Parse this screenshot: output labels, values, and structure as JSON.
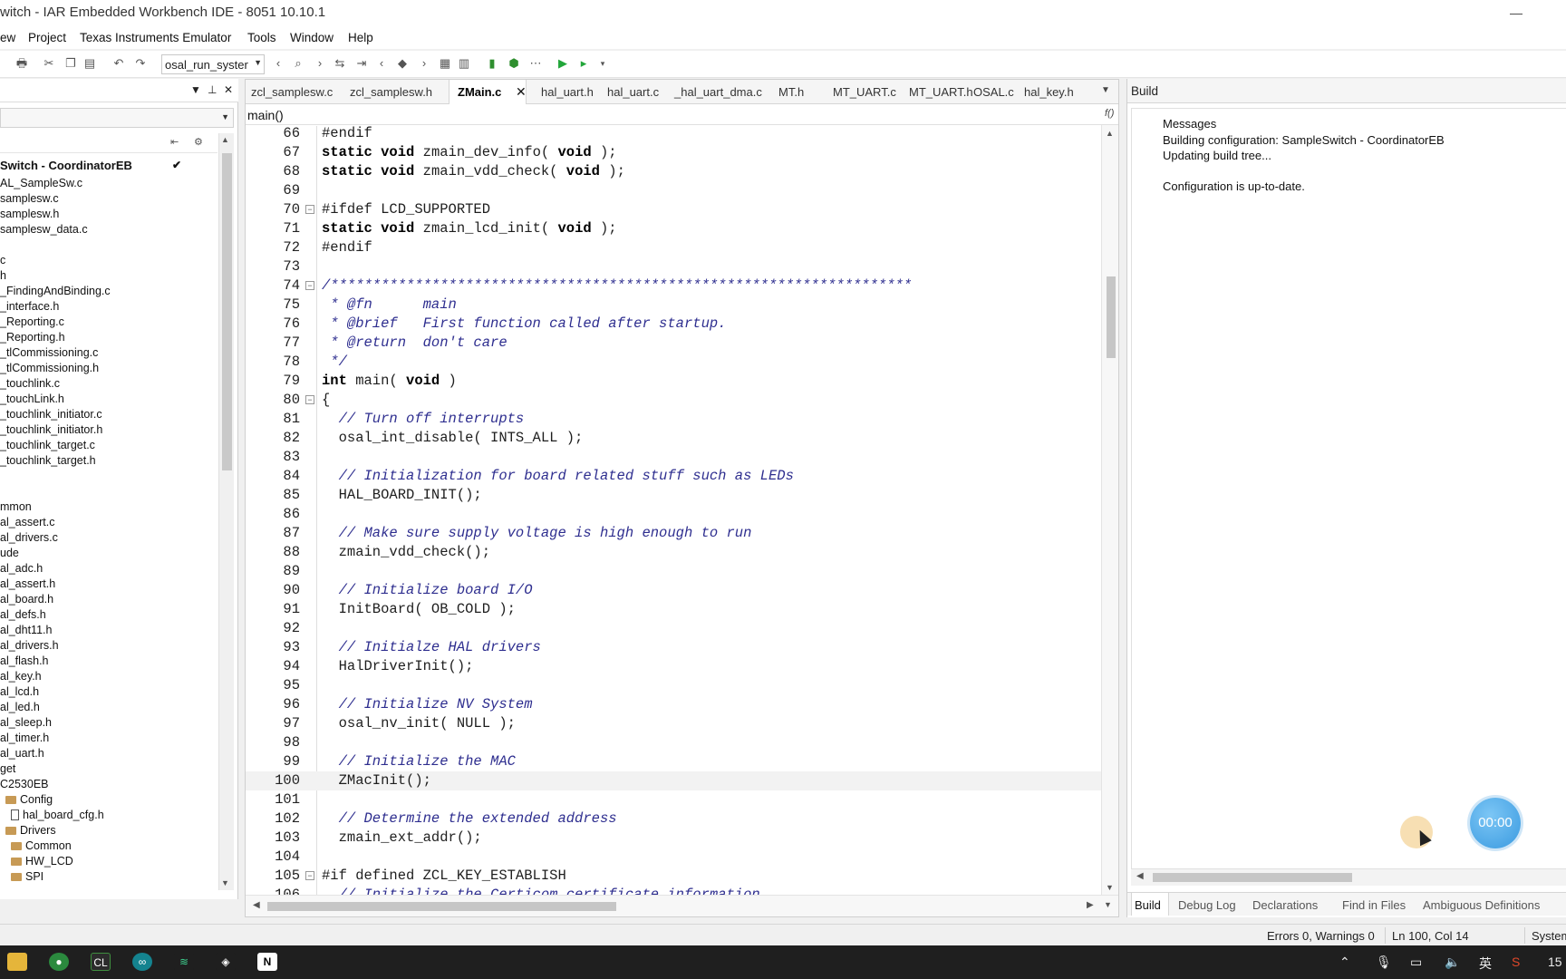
{
  "window": {
    "title": "witch - IAR Embedded Workbench IDE - 8051 10.10.1"
  },
  "menu": [
    "ew",
    "Project",
    "Texas Instruments Emulator",
    "Tools",
    "Window",
    "Help"
  ],
  "toolbar": {
    "config_combo": "osal_run_syster"
  },
  "workspace": {
    "project": "Switch - CoordinatorEB",
    "files": [
      "AL_SampleSw.c",
      "samplesw.c",
      "samplesw.h",
      "samplesw_data.c",
      "",
      "c",
      "h",
      "_FindingAndBinding.c",
      "_interface.h",
      "_Reporting.c",
      "_Reporting.h",
      "_tlCommissioning.c",
      "_tlCommissioning.h",
      "_touchlink.c",
      "_touchLink.h",
      "_touchlink_initiator.c",
      "_touchlink_initiator.h",
      "_touchlink_target.c",
      "_touchlink_target.h",
      "",
      "",
      "mmon",
      "al_assert.c",
      "al_drivers.c",
      "ude",
      "al_adc.h",
      "al_assert.h",
      "al_board.h",
      "al_defs.h",
      "al_dht11.h",
      "al_drivers.h",
      "al_flash.h",
      "al_key.h",
      "al_lcd.h",
      "al_led.h",
      "al_sleep.h",
      "al_timer.h",
      "al_uart.h",
      "get",
      "C2530EB"
    ],
    "groups": [
      {
        "label": "Config",
        "indent": 1
      },
      {
        "label": "hal_board_cfg.h",
        "indent": 2
      },
      {
        "label": "Drivers",
        "indent": 1
      },
      {
        "label": "Common",
        "indent": 2
      },
      {
        "label": "HW_LCD",
        "indent": 2
      },
      {
        "label": "SPI",
        "indent": 2
      }
    ]
  },
  "editor": {
    "tabs": [
      "zcl_samplesw.c",
      "zcl_samplesw.h",
      "ZMain.c",
      "hal_uart.h",
      "hal_uart.c",
      "_hal_uart_dma.c",
      "MT.h",
      "MT_UART.c",
      "MT_UART.h",
      "OSAL.c",
      "hal_key.h"
    ],
    "active_tab": "ZMain.c",
    "function": "main()",
    "current_line": "100",
    "lines": [
      {
        "n": "66",
        "t": "#endif",
        "fold": ""
      },
      {
        "n": "67",
        "t": "static void zmain_dev_info( void );",
        "fold": ""
      },
      {
        "n": "68",
        "t": "static void zmain_vdd_check( void );",
        "fold": ""
      },
      {
        "n": "69",
        "t": "",
        "fold": ""
      },
      {
        "n": "70",
        "t": "#ifdef LCD_SUPPORTED",
        "fold": "−"
      },
      {
        "n": "71",
        "t": "static void zmain_lcd_init( void );",
        "fold": ""
      },
      {
        "n": "72",
        "t": "#endif",
        "fold": ""
      },
      {
        "n": "73",
        "t": "",
        "fold": ""
      },
      {
        "n": "74",
        "t": "/*********************************************************************",
        "fold": "−",
        "c": true
      },
      {
        "n": "75",
        "t": " * @fn      main",
        "fold": "",
        "c": true
      },
      {
        "n": "76",
        "t": " * @brief   First function called after startup.",
        "fold": "",
        "c": true
      },
      {
        "n": "77",
        "t": " * @return  don't care",
        "fold": "",
        "c": true
      },
      {
        "n": "78",
        "t": " */",
        "fold": "",
        "c": true
      },
      {
        "n": "79",
        "t": "int main( void )",
        "fold": ""
      },
      {
        "n": "80",
        "t": "{",
        "fold": "−"
      },
      {
        "n": "81",
        "t": "  // Turn off interrupts",
        "fold": "",
        "c": true
      },
      {
        "n": "82",
        "t": "  osal_int_disable( INTS_ALL );",
        "fold": ""
      },
      {
        "n": "83",
        "t": "",
        "fold": ""
      },
      {
        "n": "84",
        "t": "  // Initialization for board related stuff such as LEDs",
        "fold": "",
        "c": true
      },
      {
        "n": "85",
        "t": "  HAL_BOARD_INIT();",
        "fold": ""
      },
      {
        "n": "86",
        "t": "",
        "fold": ""
      },
      {
        "n": "87",
        "t": "  // Make sure supply voltage is high enough to run",
        "fold": "",
        "c": true
      },
      {
        "n": "88",
        "t": "  zmain_vdd_check();",
        "fold": ""
      },
      {
        "n": "89",
        "t": "",
        "fold": ""
      },
      {
        "n": "90",
        "t": "  // Initialize board I/O",
        "fold": "",
        "c": true
      },
      {
        "n": "91",
        "t": "  InitBoard( OB_COLD );",
        "fold": ""
      },
      {
        "n": "92",
        "t": "",
        "fold": ""
      },
      {
        "n": "93",
        "t": "  // Initialze HAL drivers",
        "fold": "",
        "c": true
      },
      {
        "n": "94",
        "t": "  HalDriverInit();",
        "fold": ""
      },
      {
        "n": "95",
        "t": "",
        "fold": ""
      },
      {
        "n": "96",
        "t": "  // Initialize NV System",
        "fold": "",
        "c": true
      },
      {
        "n": "97",
        "t": "  osal_nv_init( NULL );",
        "fold": ""
      },
      {
        "n": "98",
        "t": "",
        "fold": ""
      },
      {
        "n": "99",
        "t": "  // Initialize the MAC",
        "fold": "",
        "c": true
      },
      {
        "n": "100",
        "t": "  ZMacInit();",
        "fold": ""
      },
      {
        "n": "101",
        "t": "",
        "fold": ""
      },
      {
        "n": "102",
        "t": "  // Determine the extended address",
        "fold": "",
        "c": true
      },
      {
        "n": "103",
        "t": "  zmain_ext_addr();",
        "fold": ""
      },
      {
        "n": "104",
        "t": "",
        "fold": ""
      },
      {
        "n": "105",
        "t": "#if defined ZCL_KEY_ESTABLISH",
        "fold": "−"
      },
      {
        "n": "106",
        "t": "  // Initialize the Certicom certificate information",
        "fold": "",
        "c": true
      }
    ]
  },
  "build": {
    "title": "Build",
    "header": "Messages",
    "messages": [
      "Building configuration: SampleSwitch - CoordinatorEB",
      "Updating build tree...",
      "",
      "Configuration is up-to-date."
    ],
    "tabs": [
      "Build",
      "Debug Log",
      "Declarations",
      "Find in Files",
      "Ambiguous Definitions"
    ],
    "timer": "00:00"
  },
  "status": {
    "errors": "Errors 0, Warnings 0",
    "position": "Ln 100, Col 14",
    "system": "System"
  },
  "taskbar": {
    "clock": "15"
  }
}
